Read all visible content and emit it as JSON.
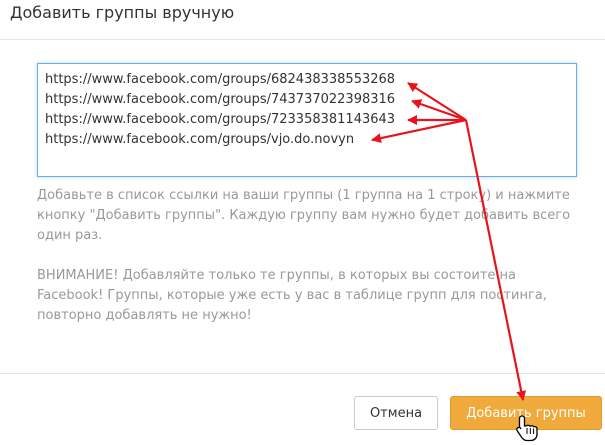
{
  "dialog": {
    "title": "Добавить группы вручную"
  },
  "textarea": {
    "value": "https://www.facebook.com/groups/682438338553268\nhttps://www.facebook.com/groups/743737022398316\nhttps://www.facebook.com/groups/723358381143643\nhttps://www.facebook.com/groups/vjo.do.novyn"
  },
  "help": {
    "line1": "Добавьте в список ссылки на ваши группы (1 группа на 1 строку) и нажмите кнопку \"Добавить группы\". Каждую группу вам нужно будет добавить всего один раз.",
    "line2": "ВНИМАНИЕ! Добавляйте только те группы, в которых вы состоите на Facebook! Группы, которые уже есть у вас в таблице групп для постинга, повторно добавлять не нужно!"
  },
  "footer": {
    "cancel_label": "Отмена",
    "add_label": "Добавить группы"
  },
  "colors": {
    "accent": "#f0a93b",
    "annotation": "#e8141b",
    "focus_border": "#66afe9"
  },
  "icons": {
    "cursor": "hand-pointer-icon"
  }
}
